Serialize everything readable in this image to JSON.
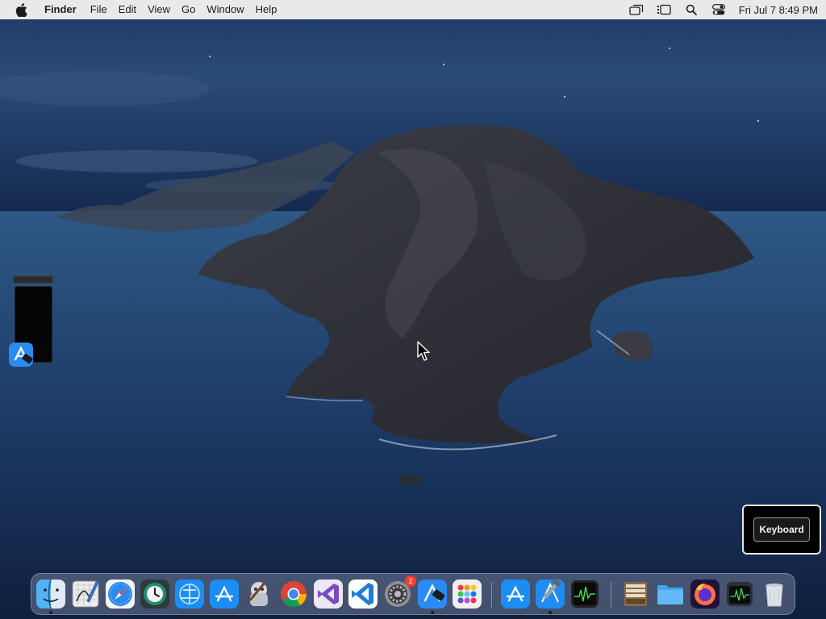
{
  "menubar": {
    "apple_icon": "apple-icon",
    "app_name": "Finder",
    "menus": [
      "File",
      "Edit",
      "View",
      "Go",
      "Window",
      "Help"
    ],
    "status_icons": [
      "screen-mirroring-icon",
      "stage-manager-icon",
      "spotlight-search-icon",
      "control-center-icon"
    ],
    "clock": "Fri Jul 7  8:49 PM"
  },
  "overlay": {
    "keyboard_label": "Keyboard"
  },
  "dock": {
    "items": [
      {
        "name": "finder-icon",
        "running": true
      },
      {
        "name": "grapher-icon",
        "running": false
      },
      {
        "name": "safari-icon",
        "running": false
      },
      {
        "name": "time-machine-icon",
        "running": false
      },
      {
        "name": "testflight-icon",
        "running": false
      },
      {
        "name": "app-store-icon",
        "running": false
      },
      {
        "name": "automator-icon",
        "running": false
      },
      {
        "name": "chrome-icon",
        "running": false
      },
      {
        "name": "visual-studio-icon",
        "running": false
      },
      {
        "name": "vscode-icon",
        "running": false
      },
      {
        "name": "system-settings-icon",
        "running": false,
        "badge": "2"
      },
      {
        "name": "xcode-developer-icon",
        "running": true
      },
      {
        "name": "launchpad-icon",
        "running": false
      },
      {
        "name": "app-store-alt-icon",
        "running": false
      },
      {
        "name": "xcode-icon",
        "running": true
      },
      {
        "name": "activity-monitor-icon",
        "running": false
      },
      {
        "name": "archive-utility-icon",
        "running": false
      },
      {
        "name": "folder-icon",
        "running": false
      },
      {
        "name": "firefox-icon",
        "running": false
      },
      {
        "name": "activity-monitor-alt-icon",
        "running": false
      },
      {
        "name": "trash-icon",
        "running": false
      }
    ]
  },
  "colors": {
    "menubar_bg": "#e9e9ec",
    "badge_red": "#ff3b30",
    "ocean": "#1a3358"
  }
}
